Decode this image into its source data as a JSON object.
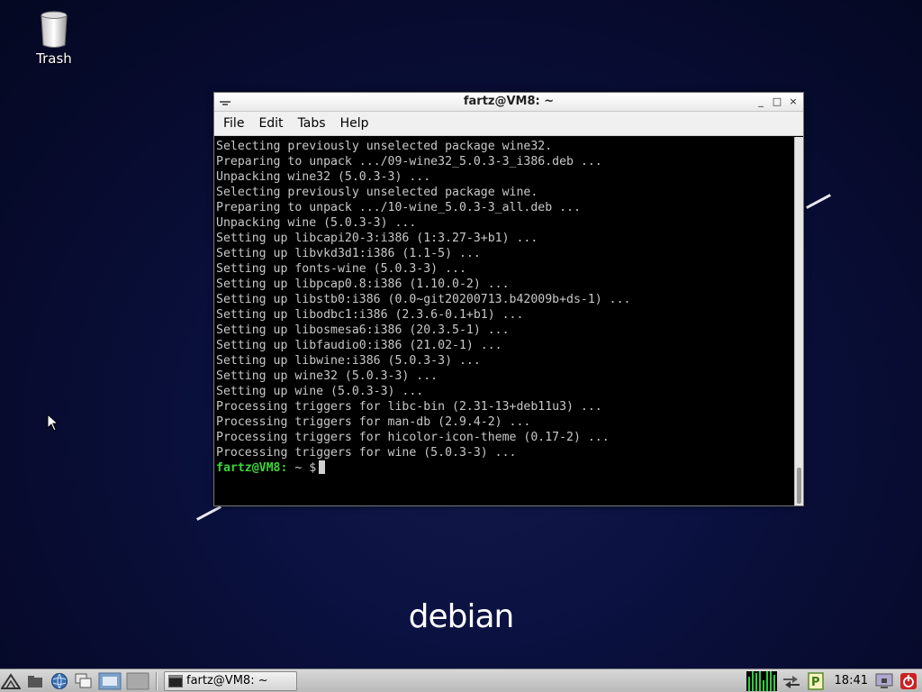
{
  "desktop": {
    "trash_label": "Trash",
    "logo_text": "debian"
  },
  "window": {
    "title": "fartz@VM8: ~",
    "controls": {
      "minimize": "_",
      "maximize": "□",
      "close": "×"
    },
    "menu": [
      "File",
      "Edit",
      "Tabs",
      "Help"
    ]
  },
  "terminal": {
    "lines": [
      "Selecting previously unselected package wine32.",
      "Preparing to unpack .../09-wine32_5.0.3-3_i386.deb ...",
      "Unpacking wine32 (5.0.3-3) ...",
      "Selecting previously unselected package wine.",
      "Preparing to unpack .../10-wine_5.0.3-3_all.deb ...",
      "Unpacking wine (5.0.3-3) ...",
      "Setting up libcapi20-3:i386 (1:3.27-3+b1) ...",
      "Setting up libvkd3d1:i386 (1.1-5) ...",
      "Setting up fonts-wine (5.0.3-3) ...",
      "Setting up libpcap0.8:i386 (1.10.0-2) ...",
      "Setting up libstb0:i386 (0.0~git20200713.b42009b+ds-1) ...",
      "Setting up libodbc1:i386 (2.3.6-0.1+b1) ...",
      "Setting up libosmesa6:i386 (20.3.5-1) ...",
      "Setting up libfaudio0:i386 (21.02-1) ...",
      "Setting up libwine:i386 (5.0.3-3) ...",
      "Setting up wine32 (5.0.3-3) ...",
      "Setting up wine (5.0.3-3) ...",
      "Processing triggers for libc-bin (2.31-13+deb11u3) ...",
      "Processing triggers for man-db (2.9.4-2) ...",
      "Processing triggers for hicolor-icon-theme (0.17-2) ...",
      "Processing triggers for wine (5.0.3-3) ..."
    ],
    "prompt_user": "fartz@VM8:",
    "prompt_path": " ~",
    "prompt_symbol": " $"
  },
  "taskbar": {
    "launchers": [
      "start-menu-icon",
      "file-manager-icon",
      "web-browser-icon",
      "show-desktop-icon",
      "workspace-1-icon",
      "workspace-2-icon"
    ],
    "task_label": "fartz@VM8: ~",
    "clock": "18:41",
    "colors": {
      "cpu": "#2ecc40",
      "prompt": "#3bd63b"
    }
  }
}
